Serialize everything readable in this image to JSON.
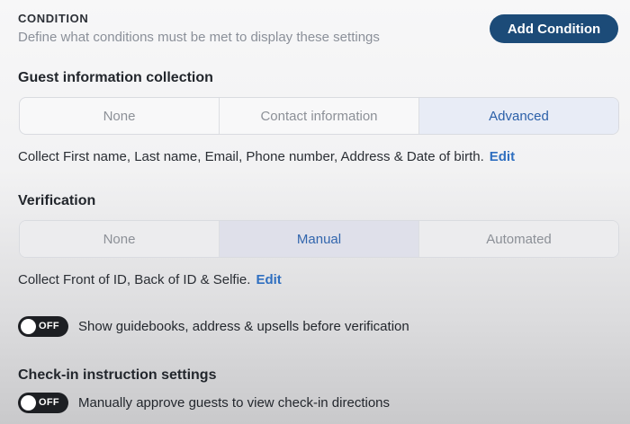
{
  "condition": {
    "title": "CONDITION",
    "description": "Define what conditions must be met to display these settings",
    "add_button_label": "Add Condition"
  },
  "guest_info": {
    "title": "Guest information collection",
    "options": [
      "None",
      "Contact information",
      "Advanced"
    ],
    "selected": "Advanced",
    "summary": "Collect First name, Last name, Email, Phone number, Address & Date of birth.",
    "edit_label": "Edit"
  },
  "verification": {
    "title": "Verification",
    "options": [
      "None",
      "Manual",
      "Automated"
    ],
    "selected": "Manual",
    "summary": "Collect Front of ID, Back of ID & Selfie.",
    "edit_label": "Edit"
  },
  "toggles": {
    "guidebooks": {
      "state": "OFF",
      "label": "Show guidebooks, address & upsells before verification"
    }
  },
  "checkin": {
    "title": "Check-in instruction settings",
    "toggle": {
      "state": "OFF",
      "label": "Manually approve guests to view check-in directions"
    }
  },
  "colors": {
    "primary_button": "#1c4b78",
    "link": "#2f6fc0",
    "active_segment_text": "#2a5fa8",
    "toggle_off": "#1d1f23"
  }
}
